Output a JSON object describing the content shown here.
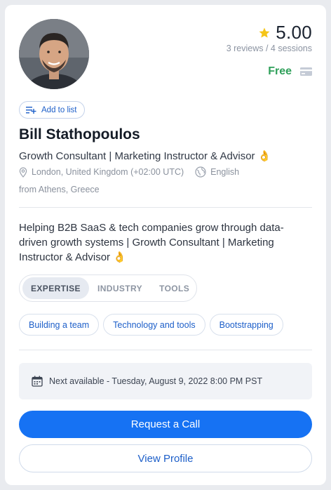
{
  "mentor": {
    "name": "Bill Stathopoulos",
    "title": "Growth Consultant | Marketing Instructor & Advisor 👌",
    "location": "London, United Kingdom (+02:00 UTC)",
    "language": "English",
    "from": "from Athens, Greece",
    "bio": "Helping B2B SaaS & tech companies grow through data-driven growth systems | Growth Consultant | Marketing Instructor & Advisor 👌"
  },
  "rating": {
    "value": "5.00",
    "reviews": "3 reviews / 4 sessions"
  },
  "price": {
    "label": "Free"
  },
  "actions": {
    "add_to_list": "Add to list",
    "request_call": "Request a Call",
    "view_profile": "View Profile"
  },
  "tabs": [
    "EXPERTISE",
    "INDUSTRY",
    "TOOLS"
  ],
  "active_tab": "EXPERTISE",
  "expertise": [
    "Building a team",
    "Technology and tools",
    "Bootstrapping"
  ],
  "availability": "Next available - Tuesday, August 9, 2022 8:00 PM PST",
  "colors": {
    "accent": "#1672f3",
    "price": "#2fa05a",
    "star": "#f5c518"
  },
  "icons": [
    "star-icon",
    "credit-card-icon",
    "add-to-list-icon",
    "location-pin-icon",
    "globe-language-icon",
    "calendar-icon"
  ]
}
